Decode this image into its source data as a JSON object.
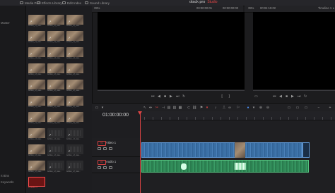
{
  "topbar": {
    "tabs": [
      {
        "label": "Media Pool"
      },
      {
        "label": "Effects Library"
      },
      {
        "label": "Edit Index"
      },
      {
        "label": "Sound Library"
      }
    ],
    "app_title": "olack pro",
    "badge": "Studio"
  },
  "bins": {
    "master_label": "Master",
    "smart_bins_label": "rt Bins",
    "keywords_label": "Keywords"
  },
  "clips": {
    "caption": "turtles_of_usa...",
    "timeline_caption": "Timeline 1"
  },
  "source_viewer": {
    "zoom": "39%",
    "timecode_left": "00:00:00:01",
    "timecode_right": "00:00:00:00"
  },
  "program_viewer": {
    "zoom": "39%",
    "timecode": "00:04:15:02",
    "timeline_name": "Timeline 1 ∨"
  },
  "timeline": {
    "timecode": "01:00:00:00",
    "tracks": [
      {
        "badge": "V1",
        "name": "Video 1"
      },
      {
        "badge": "A1",
        "name": "Audio 1"
      }
    ]
  }
}
